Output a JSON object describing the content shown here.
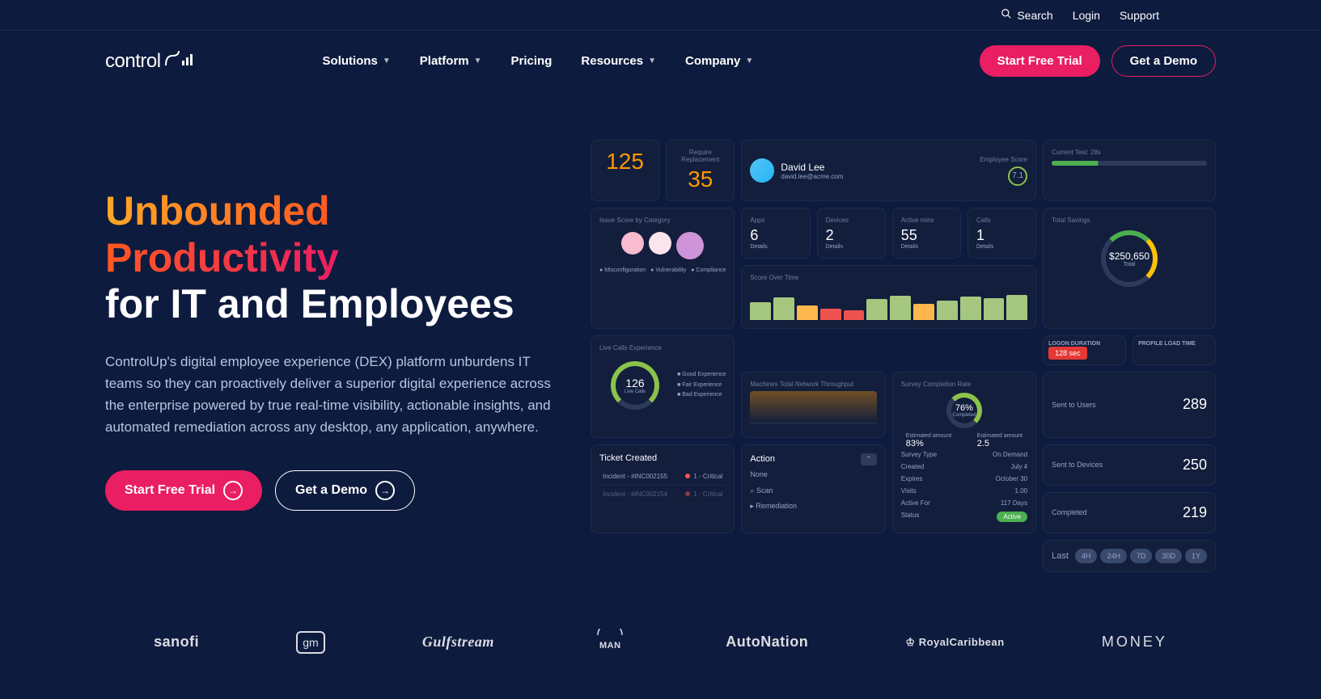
{
  "topbar": {
    "search": "Search",
    "login": "Login",
    "support": "Support"
  },
  "logo": "control",
  "nav": {
    "solutions": "Solutions",
    "platform": "Platform",
    "pricing": "Pricing",
    "resources": "Resources",
    "company": "Company",
    "trial": "Start Free Trial",
    "demo": "Get a Demo"
  },
  "hero": {
    "title_gradient": "Unbounded Productivity",
    "title_rest": "for IT and Employees",
    "desc": "ControlUp's digital employee experience (DEX) platform unburdens IT teams so they can proactively deliver a superior digital experience across the enterprise powered by true real-time visibility, actionable insights, and automated remediation across any desktop, any application, anywhere.",
    "cta_trial": "Start Free Trial",
    "cta_demo": "Get a Demo"
  },
  "dashboard": {
    "stat1": "125",
    "stat2_label": "Require Replacement",
    "stat2": "35",
    "user_name": "David Lee",
    "user_email": "david.lee@acme.com",
    "user_score_label": "Employee Score",
    "user_score": "7.1",
    "current_test": "Current Test: 28s",
    "apps_label": "Apps",
    "apps": "6",
    "apps_sub": "Details",
    "devices_label": "Devices",
    "devices": "2",
    "active_label": "Active mins",
    "active": "55",
    "calls_label": "Calls",
    "calls": "1",
    "savings_label": "Total Savings",
    "savings": "$250,650",
    "savings_sub": "Total",
    "issue_label": "Issue Score by Category",
    "score_time_label": "Score Over Time",
    "logon_label": "LOGON DURATION",
    "logon_val": "128 sec",
    "profile_label": "PROFILE LOAD TIME",
    "live_calls_label": "Live Calls Experience",
    "live_calls_num": "126",
    "live_calls_sub": "Live Calls",
    "network_label": "Machines Total Network Throughput",
    "survey_label": "Survey Completion Rate",
    "survey_pct": "76%",
    "survey_sub": "Completed",
    "est_amount": "Estimated amount",
    "est_1": "83%",
    "est_2": "2.5",
    "survey_type": "Survey Type",
    "on_demand": "On Demand",
    "created": "Created",
    "created_v": "July 4",
    "expires": "Expires",
    "expires_v": "October 30",
    "visits": "Visits",
    "visits_v": "1.00",
    "active_for": "Active For",
    "active_for_v": "117 Days",
    "status": "Status",
    "status_v": "Active",
    "sent_users": "Sent to Users",
    "sent_users_v": "289",
    "sent_devices": "Sent to Devices",
    "sent_devices_v": "250",
    "completed": "Completed",
    "completed_v": "219",
    "ticket_label": "Ticket Created",
    "ticket1_id": "Incident - #INC002155",
    "ticket1_sev": "1 - Critical",
    "ticket2_id": "Incident - #INC002154",
    "ticket2_sev": "1 - Critical",
    "action_label": "Action",
    "action_none": "None",
    "action_scan": "Scan",
    "action_remediation": "Remediation",
    "time_last": "Last",
    "t_4h": "4H",
    "t_24h": "24H",
    "t_7d": "7D",
    "t_30d": "30D",
    "t_1y": "1Y"
  },
  "clients": {
    "sanofi": "sanofi",
    "gm": "gm",
    "gulfstream": "Gulfstream",
    "man": "MAN",
    "autonation": "AutoNation",
    "royal": "RoyalCaribbean",
    "money": "MONEY"
  }
}
